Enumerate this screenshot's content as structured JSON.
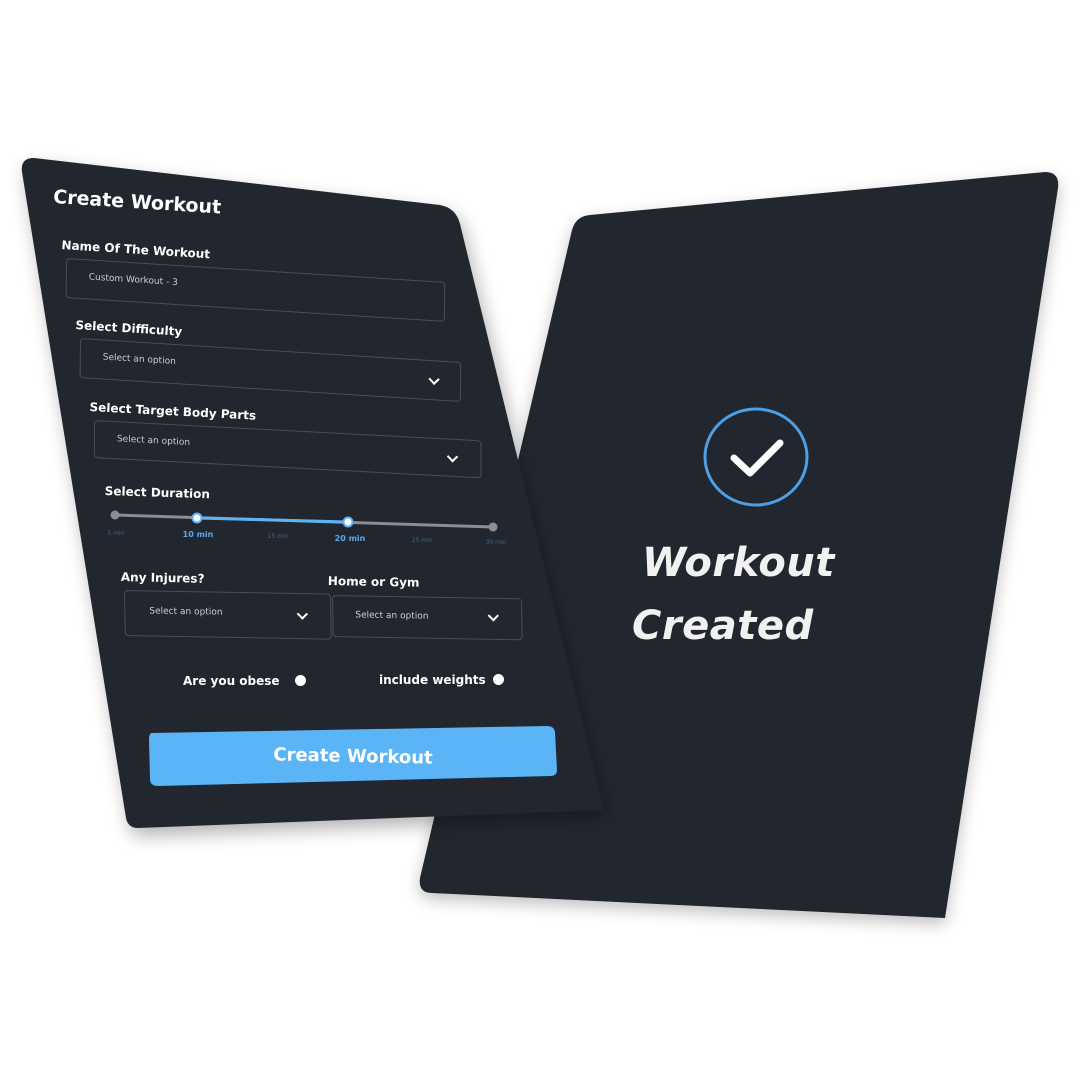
{
  "colors": {
    "card_bg": "#23262f",
    "accent": "#5ab4f6",
    "check_ring": "#4d9fe6",
    "text": "#ffffff"
  },
  "form": {
    "title": "Create Workout",
    "name_label": "Name Of The Workout",
    "name_value": "Custom Workout - 3",
    "difficulty_label": "Select Difficulty",
    "difficulty_value": "Select an option",
    "body_parts_label": "Select Target Body Parts",
    "body_parts_value": "Select an option",
    "duration_label": "Select Duration",
    "duration_ticks": [
      "5 min",
      "10 min",
      "15 min",
      "20 min",
      "25 min",
      "30 min"
    ],
    "duration_range": [
      "10 min",
      "20 min"
    ],
    "injuries_label": "Any Injures?",
    "injuries_value": "Select an option",
    "location_label": "Home or Gym",
    "location_value": "Select an option",
    "obese_label": "Are you obese",
    "weights_label": "include weights",
    "submit_label": "Create Workout"
  },
  "success": {
    "icon": "check-circle-icon",
    "line1": "Workout",
    "line2": "Created"
  }
}
